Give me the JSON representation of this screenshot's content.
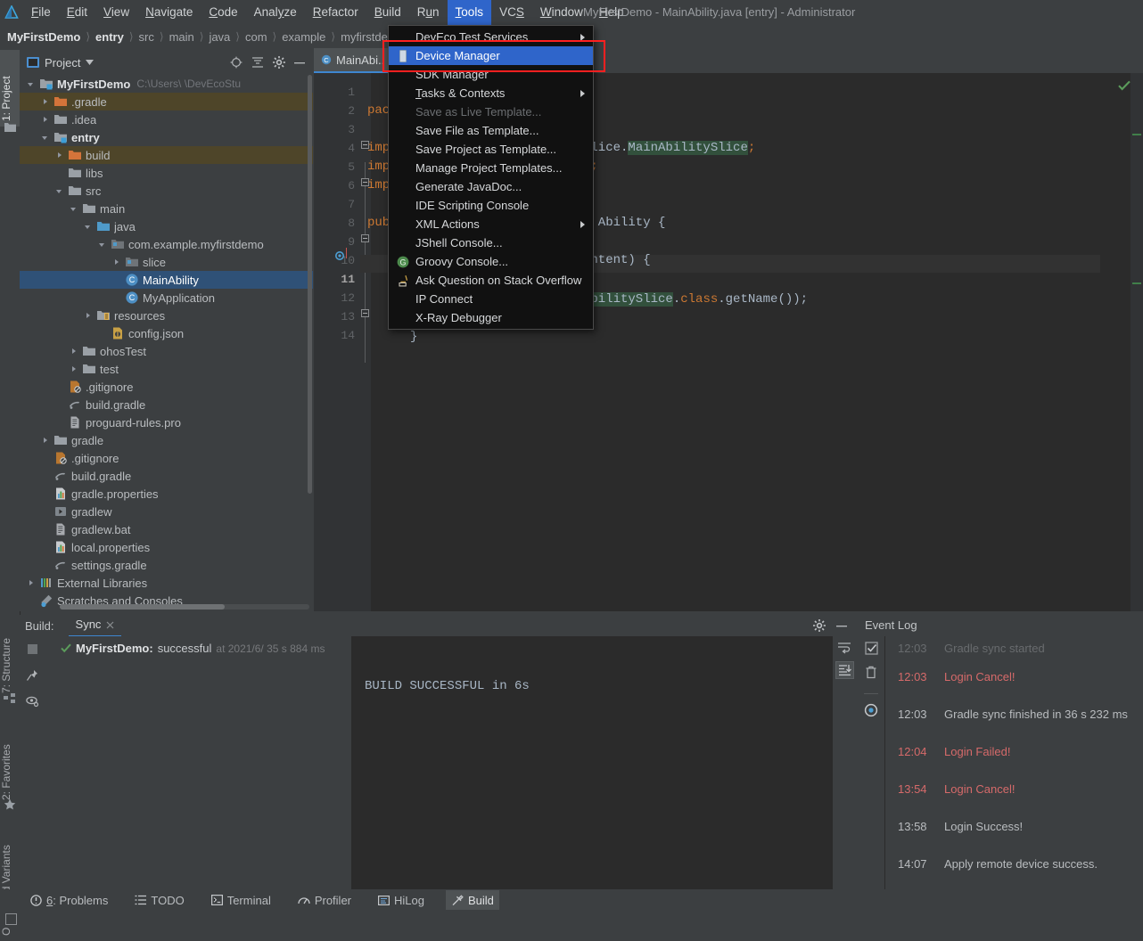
{
  "window": {
    "title": "MyFirstDemo - MainAbility.java [entry] - Administrator",
    "logo_icon": "deveco-logo-icon"
  },
  "menubar": {
    "items": [
      {
        "label": "File",
        "accel": "F"
      },
      {
        "label": "Edit",
        "accel": "E"
      },
      {
        "label": "View",
        "accel": "V"
      },
      {
        "label": "Navigate",
        "accel": "N"
      },
      {
        "label": "Code",
        "accel": "C"
      },
      {
        "label": "Analyze",
        "accel": "z"
      },
      {
        "label": "Refactor",
        "accel": "R"
      },
      {
        "label": "Build",
        "accel": "B"
      },
      {
        "label": "Run",
        "accel": "u"
      },
      {
        "label": "Tools",
        "accel": "T",
        "active": true
      },
      {
        "label": "VCS",
        "accel": "S"
      },
      {
        "label": "Window",
        "accel": "W"
      },
      {
        "label": "Help",
        "accel": "H"
      }
    ]
  },
  "tools_menu": {
    "items": [
      {
        "label": "DevEco Test Services",
        "submenu": true,
        "icon": ""
      },
      {
        "label": "Device Manager",
        "selected": true,
        "icon": "device-manager-icon",
        "highlighted_box": true
      },
      {
        "label": "SDK Manager",
        "icon": ""
      },
      {
        "separator_after": true
      },
      {
        "label": "Tasks & Contexts",
        "submenu": true,
        "accel": "T"
      },
      {
        "separator_after": true
      },
      {
        "label": "Save as Live Template...",
        "disabled": true
      },
      {
        "label": "Save File as Template..."
      },
      {
        "label": "Save Project as Template..."
      },
      {
        "label": "Manage Project Templates..."
      },
      {
        "label": "Generate JavaDoc..."
      },
      {
        "separator_after": true
      },
      {
        "label": "IDE Scripting Console"
      },
      {
        "separator_after": true
      },
      {
        "label": "XML Actions",
        "submenu": true
      },
      {
        "label": "JShell Console..."
      },
      {
        "label": "Groovy Console...",
        "icon": "groovy-icon"
      },
      {
        "label": "Ask Question on Stack Overflow",
        "icon": "stackoverflow-icon"
      },
      {
        "label": "IP Connect"
      },
      {
        "label": "X-Ray Debugger"
      }
    ]
  },
  "breadcrumb": {
    "items": [
      "MyFirstDemo",
      "entry",
      "src",
      "main",
      "java",
      "com",
      "example",
      "myfirstdemo"
    ]
  },
  "left_rail": {
    "top": [
      {
        "label": "1: Project",
        "selected": true,
        "icon": "project-folder-icon"
      }
    ],
    "bottom": [
      {
        "label": "7: Structure",
        "icon": "structure-icon"
      },
      {
        "label": "2: Favorites",
        "icon": "star-icon"
      },
      {
        "label": "OhosBuild Variants",
        "icon": "variants-icon"
      }
    ]
  },
  "project_panel": {
    "title": "Project",
    "dropdown_icon": "chevron-down-icon",
    "toolbar_icons": [
      "locate-icon",
      "collapse-all-icon",
      "settings-gear-icon",
      "minimize-icon"
    ],
    "tree": [
      {
        "depth": 0,
        "arrow": "down",
        "icon": "module-icon",
        "label": "MyFirstDemo",
        "bold": true,
        "suffix": "C:\\Users\\                    \\DevEcoStu"
      },
      {
        "depth": 1,
        "arrow": "right",
        "icon": "folder-orange-icon",
        "label": ".gradle",
        "row_highlight": "excluded"
      },
      {
        "depth": 1,
        "arrow": "right",
        "icon": "folder-icon",
        "label": ".idea"
      },
      {
        "depth": 1,
        "arrow": "down",
        "icon": "module-icon",
        "label": "entry",
        "bold": true
      },
      {
        "depth": 2,
        "arrow": "right",
        "icon": "folder-orange-icon",
        "label": "build",
        "row_highlight": "excluded"
      },
      {
        "depth": 2,
        "arrow": "none",
        "icon": "folder-icon",
        "label": "libs"
      },
      {
        "depth": 2,
        "arrow": "down",
        "icon": "folder-icon",
        "label": "src"
      },
      {
        "depth": 3,
        "arrow": "down",
        "icon": "folder-icon",
        "label": "main"
      },
      {
        "depth": 4,
        "arrow": "down",
        "icon": "folder-source-icon",
        "label": "java"
      },
      {
        "depth": 5,
        "arrow": "down",
        "icon": "package-icon",
        "label": "com.example.myfirstdemo"
      },
      {
        "depth": 6,
        "arrow": "right",
        "icon": "package-icon",
        "label": "slice"
      },
      {
        "depth": 6,
        "arrow": "none",
        "icon": "class-icon",
        "label": "MainAbility",
        "selected": true
      },
      {
        "depth": 6,
        "arrow": "none",
        "icon": "class-icon",
        "label": "MyApplication"
      },
      {
        "depth": 4,
        "arrow": "right",
        "icon": "resources-icon",
        "label": "resources"
      },
      {
        "depth": 5,
        "arrow": "none",
        "icon": "json-icon",
        "label": "config.json"
      },
      {
        "depth": 3,
        "arrow": "right",
        "icon": "folder-icon",
        "label": "ohosTest"
      },
      {
        "depth": 3,
        "arrow": "right",
        "icon": "folder-icon",
        "label": "test"
      },
      {
        "depth": 2,
        "arrow": "none",
        "icon": "gitignore-icon",
        "label": ".gitignore"
      },
      {
        "depth": 2,
        "arrow": "none",
        "icon": "gradle-icon",
        "label": "build.gradle"
      },
      {
        "depth": 2,
        "arrow": "none",
        "icon": "text-file-icon",
        "label": "proguard-rules.pro"
      },
      {
        "depth": 1,
        "arrow": "right",
        "icon": "folder-icon",
        "label": "gradle"
      },
      {
        "depth": 1,
        "arrow": "none",
        "icon": "gitignore-icon",
        "label": ".gitignore"
      },
      {
        "depth": 1,
        "arrow": "none",
        "icon": "gradle-icon",
        "label": "build.gradle"
      },
      {
        "depth": 1,
        "arrow": "none",
        "icon": "properties-icon",
        "label": "gradle.properties"
      },
      {
        "depth": 1,
        "arrow": "none",
        "icon": "script-icon",
        "label": "gradlew"
      },
      {
        "depth": 1,
        "arrow": "none",
        "icon": "text-file-icon",
        "label": "gradlew.bat"
      },
      {
        "depth": 1,
        "arrow": "none",
        "icon": "properties-icon",
        "label": "local.properties"
      },
      {
        "depth": 1,
        "arrow": "none",
        "icon": "gradle-icon",
        "label": "settings.gradle"
      },
      {
        "depth": 0,
        "arrow": "right",
        "icon": "libraries-icon",
        "label": "External Libraries"
      },
      {
        "depth": 0,
        "arrow": "none",
        "icon": "scratches-icon",
        "label": "Scratches and Consoles"
      }
    ]
  },
  "editor": {
    "tab": {
      "label": "MainAbi..",
      "icon": "class-icon"
    },
    "line_numbers": [
      "1",
      "2",
      "3",
      "4",
      "5",
      "6",
      "7",
      "8",
      "9",
      "10",
      "11",
      "12",
      "13",
      "14"
    ],
    "current_line": 11,
    "inspection_status": "ok-check-icon",
    "code": [
      {
        "line": 1,
        "text": "package",
        "cls": "kw"
      },
      {
        "line": 3,
        "text": "import",
        "cls": "kw"
      },
      {
        "line": 4,
        "text": "import",
        "cls": "kw"
      },
      {
        "line": 5,
        "text": "import",
        "cls": "kw"
      },
      {
        "line": 7,
        "text": "public",
        "cls": "kw"
      },
      {
        "line": 3,
        "text": "slice.MainAbilitySlice;",
        "right": true
      },
      {
        "line": 4,
        "text": "y;",
        "right": true
      },
      {
        "line": 5,
        "text": ";",
        "right": true
      },
      {
        "line": 7,
        "text": "s Ability {",
        "right": true
      },
      {
        "line": 9,
        "text": "intent) {",
        "right": true
      },
      {
        "line": 11,
        "text": "AbilitySlice.class.getName());",
        "right": true
      },
      {
        "line": 13,
        "text": "}",
        "right": true
      }
    ]
  },
  "build_panel": {
    "label": "Build:",
    "tab": {
      "label": "Sync",
      "close_icon": "close-icon"
    },
    "header_icons": [
      "settings-gear-icon",
      "minimize-icon"
    ],
    "side_icons": [
      "stop-icon",
      "pin-icon",
      "eye-icon"
    ],
    "right_icons": [
      "soft-wrap-icon",
      "scroll-to-end-icon"
    ],
    "entry": {
      "status_icon": "green-check-icon",
      "project": "MyFirstDemo:",
      "result": "successful",
      "detail": "at 2021/6/  35 s 884 ms"
    },
    "console_text": "BUILD SUCCESSFUL in 6s"
  },
  "event_log": {
    "title": "Event Log",
    "side_icons": [
      "mark-read-icon",
      "trash-icon",
      "settings-dot-icon"
    ],
    "entries": [
      {
        "time": "12:03",
        "message": "Gradle sync started",
        "type": "info",
        "clipped": true
      },
      {
        "time": "12:03",
        "message": "Login Cancel!",
        "type": "error"
      },
      {
        "time": "12:03",
        "message": "Gradle sync finished in 36 s 232 ms",
        "type": "info"
      },
      {
        "time": "12:04",
        "message": "Login Failed!",
        "type": "error"
      },
      {
        "time": "13:54",
        "message": "Login Cancel!",
        "type": "error"
      },
      {
        "time": "13:58",
        "message": "Login Success!",
        "type": "info"
      },
      {
        "time": "14:07",
        "message": "Apply remote device success.",
        "type": "info"
      }
    ]
  },
  "status_bar": {
    "items": [
      {
        "label": "6: Problems",
        "icon": "problems-icon",
        "accel": "6"
      },
      {
        "label": "TODO",
        "icon": "todo-icon"
      },
      {
        "label": "Terminal",
        "icon": "terminal-icon"
      },
      {
        "label": "Profiler",
        "icon": "profiler-icon"
      },
      {
        "label": "HiLog",
        "icon": "hilog-icon"
      },
      {
        "label": "Build",
        "icon": "build-hammer-icon",
        "selected": true
      }
    ]
  },
  "colors": {
    "accent_blue": "#2f65ca",
    "highlight_red": "#ff2020",
    "panel_bg": "#3c3f41",
    "editor_bg": "#2b2b2b",
    "selection": "#2f5177",
    "error_text": "#d66a6a",
    "success_green": "#5b9c5b"
  }
}
